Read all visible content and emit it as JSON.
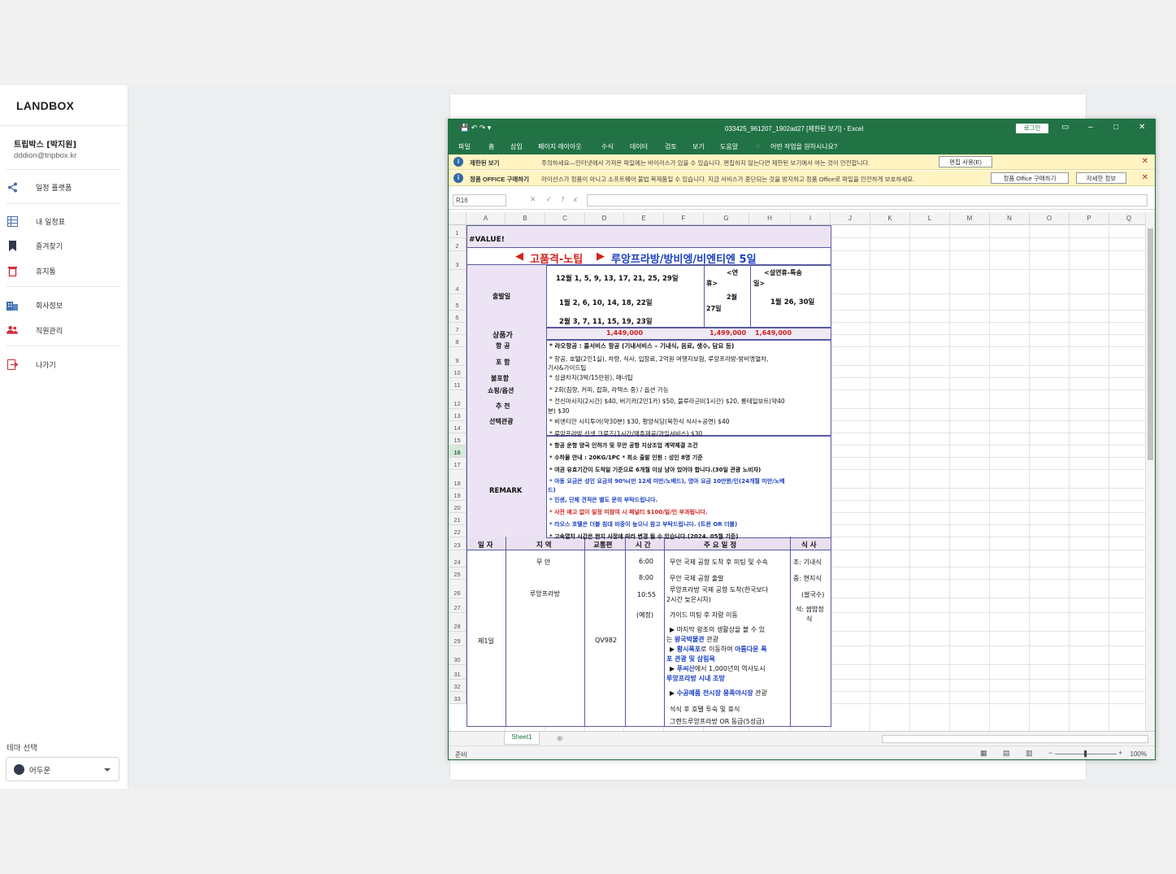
{
  "sidebar": {
    "logo": "LANDBOX",
    "user_name": "트립박스 [박지원]",
    "user_email": "dddion@tripbox.kr",
    "items": [
      {
        "label": "일정 플랫폼"
      },
      {
        "label": "내 일정표"
      },
      {
        "label": "즐겨찾기"
      },
      {
        "label": "휴지통"
      },
      {
        "label": "회사정보"
      },
      {
        "label": "직원관리"
      },
      {
        "label": "나가기"
      }
    ],
    "theme_label": "테마 선택",
    "theme_value": "어두운"
  },
  "excel": {
    "title": "033425_961207_1902ad27 [제한된 보기] - Excel",
    "login": "로그인",
    "menu": [
      "파일",
      "홈",
      "삽입",
      "페이지 레이아웃",
      "수식",
      "데이터",
      "검토",
      "보기",
      "도움말",
      "어떤 작업을 원하시나요?"
    ],
    "protected_view": {
      "title": "제한된 보기",
      "message": "주의하세요—인터넷에서 가져온 파일에는 바이러스가 있을 수 있습니다. 편집하지 않는다면 제한된 보기에서 여는 것이 안전합니다.",
      "button": "편집 사용(E)"
    },
    "license_bar": {
      "title": "정품 OFFICE 구매하기",
      "message": "라이선스가 정품이 아니고 소프트웨어 불법 복제품일 수 있습니다. 지금 서비스가 중단되는 것을 방지하고 정품 Office로 파일을 안전하게 보호하세요.",
      "button1": "정품 Office 구매하기",
      "button2": "자세한 정보"
    },
    "namebox": "R16",
    "columns": [
      "A",
      "B",
      "C",
      "D",
      "E",
      "F",
      "G",
      "H",
      "I",
      "J",
      "K",
      "L",
      "M",
      "N",
      "O",
      "P",
      "Q"
    ],
    "sheet_tab": "Sheet1",
    "status": "준비",
    "zoom": "100%"
  },
  "sheet": {
    "r2": "#VALUE!",
    "r3_title_a": "고품격-노팁",
    "r3_title_b": "루앙프라방/방비엥/비엔티엔 5일",
    "depart_label": "출발일",
    "dates1": "12월 1, 5, 9, 13, 17, 21, 25, 29일",
    "dates2": "1월 2, 6, 10, 14, 18, 22일",
    "dates3": "2월 3, 7, 11, 15, 19, 23일",
    "g_hol_a": "<연",
    "g_hol_b": "휴>",
    "g_hol_c": "2월",
    "g_hol_d": "27일",
    "h_hol_a": "<설연휴-특송",
    "h_hol_b": "일>",
    "h_hol_c": "1월 26, 30일",
    "price_label": "상품가",
    "price1": "1,449,000",
    "price2": "1,499,000",
    "price3": "1,649,000",
    "air_label": "항 공",
    "air": "* 라오항공 : 풀서비스 항공 (기내서비스 – 기내식, 음료, 생수, 담요 등)",
    "incl_label": "포 함",
    "incl_a": "* 항공, 호텔(2인1실), 차량, 식사, 입장료, 2억원 여행자보험, 루앙프라방-방비엥열차,",
    "incl_b": "기사&가이드팁",
    "excl_label": "불포함",
    "excl": "* 싱글차지(3박/15만원), 매너팁",
    "shop_label": "쇼핑/옵션",
    "shop": "* 2회(침향, 커피, 잡화, 라텍스 중) / 옵션 가능",
    "rec_label_a": "추 천",
    "rec_label_b": "선택관광",
    "rec1a": "* 전신마사지(2시간) $40, 버기카(2인1카) $50, 블루라군II(1시간) $20, 롱테일보트(약40",
    "rec1b": "분) $30",
    "rec2": "* 비엔티안 시티투어(약30분) $30, 평양식당(북한식 식사+공연) $40",
    "rec3": "* 루앙프라방 선셋 크루즈(1시간/맥주제공/과일서비스) $30",
    "remark_label": "REMARK",
    "rm1": "* 항공 운항 양국 인허가 및 무안 공항 지상조업 계약체결 조건",
    "rm2": "* 수하물 안내 : 20KG/1PC      * 최소 출발 인원 : 성인 8명 기준",
    "rm3": "* 여권 유효기간이 도착일 기준으로 6개월 이상 남아 있어야 합니다.(30일 관광 노비자)",
    "rm4a": "* 아동 요금은 성인 요금의 90%(만 12세 미만/노베드), 영아 요금 10만원/인(24개월 미만/노베",
    "rm4b": "드)",
    "rm5": "* 인센, 단체 견적은 별도 문의 부탁드립니다.",
    "rm6": "* 사전 예고 없이 일정 미참여 시 패널티 $100/일/인 부과됩니다.",
    "rm7": "* 라오스 호텔은 더블 침대 비중이 높으니 참고 부탁드립니다. (트윈 OR 더블)",
    "rm8": "* 고속열차 시간은 현지 사정에 따라 변경 될 수 있습니다.(2024. 05월 기준)",
    "hdr_day": "일 자",
    "hdr_region": "지 역",
    "hdr_transport": "교통편",
    "hdr_time": "시 간",
    "hdr_schedule": "주 요 일 정",
    "hdr_meal": "식 사",
    "day1": "제1일",
    "region1": "무 안",
    "region2": "루앙프라방",
    "flight": "QV982",
    "time1": "6:00",
    "time2": "8:00",
    "time3": "10:55",
    "time4": "(예정)",
    "s1": "무안 국제 공항 도착 후 미팅 및 수속",
    "s2": "무안 국제 공항 출발",
    "s3a": "루앙프라방 국제 공항 도착(한국보다",
    "s3b": "2시간 늦은시차)",
    "s4": "가이드 미팅 후 차량 이동",
    "s5a": "▶ 마지막 왕조의 생활상을 볼 수 있",
    "s5b_pre": "는 ",
    "s5b": "왕국박물관",
    "s5b_post": " 관광",
    "s6a_pre": "▶ ",
    "s6a": "황시폭포",
    "s6a_mid": "로 이동하여 ",
    "s6a_end": "아름다운 폭",
    "s6b": "포 관광 및 삼림욕",
    "s7a_pre": "▶ ",
    "s7a": "푸씨산",
    "s7a_post": "에서 1,000년의 역사도시",
    "s7b": "루앙프라방 시내 조망",
    "s8_pre": "▶ ",
    "s8": "수공예품 전시장 몽족야시장",
    "s8_post": " 관광",
    "s9": "석식 후 호텔 투숙 및 휴식",
    "s10": "그랜드루앙프라방 OR 동급(5성급)",
    "meal1": "조: 기내식",
    "meal2": "중: 현지식",
    "meal3": "(쌀국수)",
    "meal4a": "석: 쌈밥정",
    "meal4b": "식"
  }
}
